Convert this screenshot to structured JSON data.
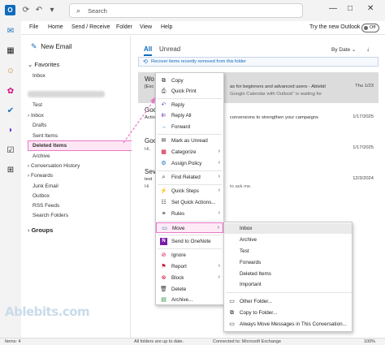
{
  "titlebar": {
    "search_placeholder": "Search"
  },
  "menubar": {
    "items": [
      "File",
      "Home",
      "Send / Receive",
      "Folder",
      "View",
      "Help"
    ],
    "try_new": "Try the new Outlook",
    "toggle_label": "Off"
  },
  "folders": {
    "new_email": "New Email",
    "favorites": "Favorites",
    "fav_inbox": "Inbox",
    "items": [
      "Test",
      "Inbox",
      "Drafts",
      "Sent Items",
      "Deleted Items",
      "Archive",
      "Conversation History",
      "Forwards",
      "Junk Email",
      "Outbox",
      "RSS Feeds",
      "Search Folders"
    ],
    "groups": "Groups"
  },
  "list": {
    "tab_all": "All",
    "tab_unread": "Unread",
    "sort": "By Date",
    "banner": "Recover items recently removed from this folder",
    "messages": [
      {
        "from": "Wo",
        "l2": "[Exc",
        "l2b": "as for beginners and advanced users - Ablebit",
        "l3b": "Google Calendar with Outlook\" is waiting for",
        "date": "Thu 1/23"
      },
      {
        "from": "Goo",
        "l2": "Actio",
        "l2b": "conversions to strengthen your campaigns",
        "l3": "",
        "date": "1/17/2025"
      },
      {
        "from": "Goo",
        "l2": "",
        "l3": "Hi, ",
        "date": "1/17/2025"
      },
      {
        "from": "Seve",
        "l2": "test",
        "l3": "Hi ",
        "l3b": "to ask me.",
        "date": "12/3/2024"
      }
    ]
  },
  "context_menu": {
    "items": [
      {
        "icon": "copy-icon",
        "glyph": "⧉",
        "label": "Copy"
      },
      {
        "icon": "quick-print-icon",
        "glyph": "⎙",
        "label": "Quick Print"
      },
      {
        "icon": "reply-icon",
        "glyph": "↶",
        "label": "Reply"
      },
      {
        "icon": "reply-all-icon",
        "glyph": "↶",
        "label": "Reply All"
      },
      {
        "icon": "forward-icon",
        "glyph": "→",
        "label": "Forward"
      },
      {
        "icon": "mark-unread-icon",
        "glyph": "✉",
        "label": "Mark as Unread"
      },
      {
        "icon": "categorize-icon",
        "glyph": "▦",
        "label": "Categorize"
      },
      {
        "icon": "retention-icon",
        "glyph": "⚙",
        "label": "Assign Policy"
      },
      {
        "icon": "find-related-icon",
        "glyph": "⌕",
        "label": "Find Related"
      },
      {
        "icon": "quick-steps-icon",
        "glyph": "⚡",
        "label": "Quick Steps"
      },
      {
        "icon": "quick-actions-icon",
        "glyph": "☷",
        "label": "Set Quick Actions..."
      },
      {
        "icon": "rules-icon",
        "glyph": "≡",
        "label": "Rules"
      },
      {
        "icon": "move-icon",
        "glyph": "▭",
        "label": "Move"
      },
      {
        "icon": "onenote-icon",
        "glyph": "N",
        "label": "Send to OneNote"
      },
      {
        "icon": "ignore-icon",
        "glyph": "⊘",
        "label": "Ignore"
      },
      {
        "icon": "report-icon",
        "glyph": "⚑",
        "label": "Report"
      },
      {
        "icon": "block-icon",
        "glyph": "⊗",
        "label": "Block"
      },
      {
        "icon": "delete-icon",
        "glyph": "✕",
        "label": "Delete"
      },
      {
        "icon": "archive-icon",
        "glyph": "▤",
        "label": "Archive..."
      }
    ]
  },
  "move_submenu": {
    "folders": [
      "Inbox",
      "Archive",
      "Test",
      "Forwards",
      "Deleted Items",
      "Important"
    ],
    "other_folder": "Other Folder...",
    "copy_to_folder": "Copy to Folder...",
    "always_move": "Always Move Messages in This Conversation..."
  },
  "statusbar": {
    "items": "Items: 4",
    "sync": "All folders are up to date.",
    "connection": "Connected to: Microsoft Exchange",
    "zoom": "100%"
  },
  "watermark": "Ablebits.com",
  "colors": {
    "accent": "#0f6cbd",
    "highlight_border": "#e879c7",
    "highlight_fill": "#fde7f5"
  }
}
